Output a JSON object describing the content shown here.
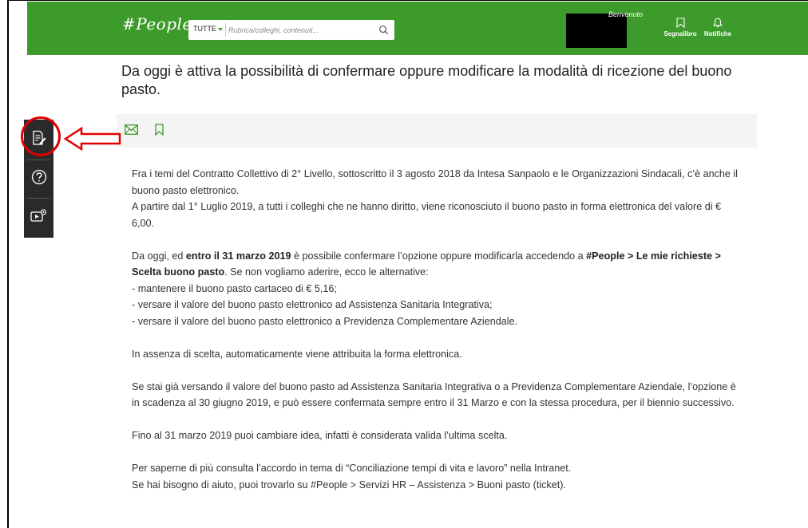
{
  "header": {
    "logo": "#People",
    "search": {
      "category": "TUTTE",
      "placeholder": "Rubrica/colleghi, contenuti..."
    },
    "welcome": "Benvenuto",
    "bookmark_label": "Segnalibro",
    "notifications_label": "Notifiche"
  },
  "article": {
    "title": "Da oggi è attiva la possibilità di confermare oppure modificare la modalità di ricezione del buono pasto.",
    "p1_line1": "Fra i temi del Contratto Collettivo di 2° Livello, sottoscritto il 3 agosto 2018 da Intesa Sanpaolo e le Organizzazioni Sindacali, c’è anche il buono pasto elettronico.",
    "p1_line2": "A partire dal 1° Luglio 2019, a tutti i colleghi che ne hanno diritto, viene riconosciuto il buono pasto in forma elettronica del valore di € 6,00.",
    "p2_a": "Da oggi, ed ",
    "p2_bold1": "entro il 31 marzo 2019",
    "p2_b": " è possibile confermare l’opzione oppure modificarla accedendo a ",
    "p2_bold2": "#People > Le mie richieste > Scelta buono pasto",
    "p2_c": ". Se non vogliamo aderire, ecco le alternative:",
    "alt1": "- mantenere il buono pasto cartaceo di € 5,16;",
    "alt2": "- versare il valore del buono pasto elettronico ad Assistenza Sanitaria Integrativa;",
    "alt3": "- versare il valore del buono pasto elettronico a Previdenza Complementare Aziendale.",
    "p3": "In assenza di scelta, automaticamente viene attribuita la forma elettronica.",
    "p4": "Se stai già versando il valore del buono pasto ad Assistenza Sanitaria Integrativa o a Previdenza Complementare Aziendale, l’opzione è in scadenza al 30 giugno 2019, e può essere confermata sempre entro il 31 Marzo e con la stessa procedura, per il biennio successivo.",
    "p5": "Fino al 31 marzo 2019 puoi cambiare idea, infatti è considerata valida l’ultima scelta.",
    "p6_line1": "Per saperne di più consulta l’accordo in tema di “Conciliazione tempi di vita e lavoro” nella Intranet.",
    "p6_line2": "Se hai bisogno di aiuto, puoi trovarlo su #People > Servizi HR – Assistenza > Buoni pasto (ticket)."
  },
  "side_toolbar": {
    "items": [
      "notes-icon",
      "help-icon",
      "video-settings-icon"
    ]
  },
  "colors": {
    "brand_green": "#3c9b2a",
    "toolbar_dark": "#2a2a2a",
    "annotation_red": "#e00000"
  }
}
